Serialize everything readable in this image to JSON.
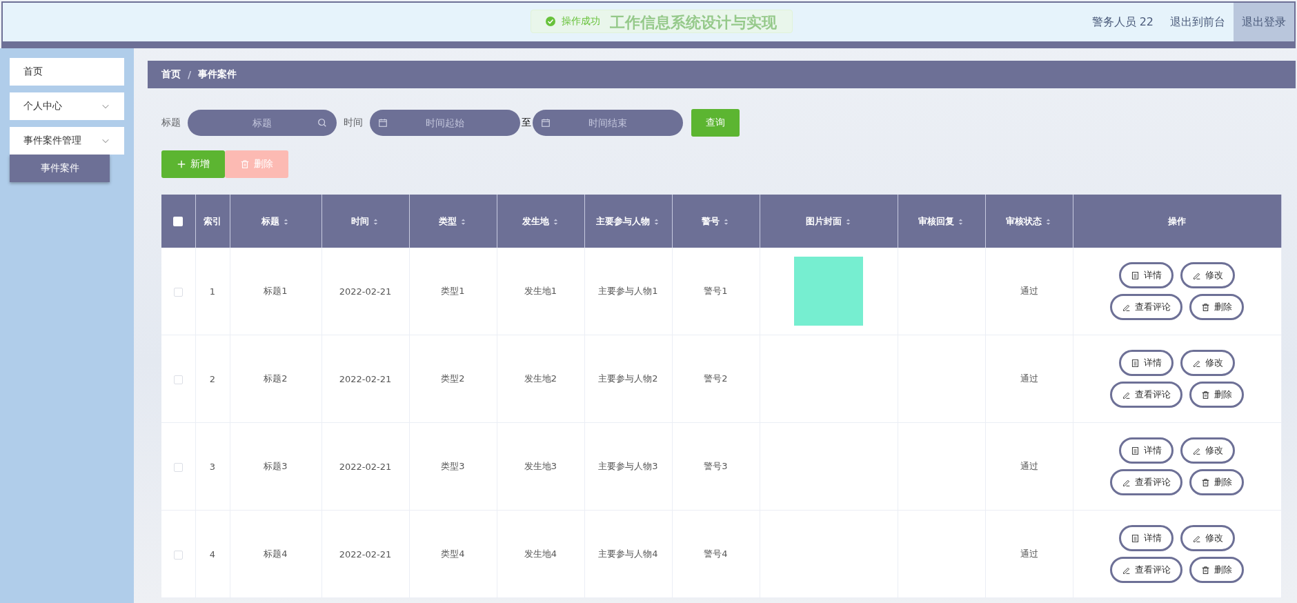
{
  "header": {
    "title": "工作信息系统设计与实现",
    "toast": "操作成功",
    "user": "警务人员 22",
    "links": [
      {
        "label": "退出到前台",
        "selected": false
      },
      {
        "label": "退出登录",
        "selected": true
      }
    ]
  },
  "sidebar": {
    "items": [
      {
        "label": "首页",
        "expandable": false
      },
      {
        "label": "个人中心",
        "expandable": true
      },
      {
        "label": "事件案件管理",
        "expandable": true,
        "children": [
          {
            "label": "事件案件",
            "selected": true
          }
        ]
      }
    ]
  },
  "breadcrumb": {
    "items": [
      "首页",
      "事件案件"
    ],
    "separator": "/"
  },
  "search": {
    "title_label": "标题",
    "title_placeholder": "标题",
    "time_label": "时间",
    "start_placeholder": "时间起始",
    "separator": "至",
    "end_placeholder": "时间结束",
    "query_button": "查询"
  },
  "actions": [
    {
      "kind": "add",
      "label": "新增",
      "disabled": false
    },
    {
      "kind": "delete",
      "label": "删除",
      "disabled": true
    }
  ],
  "table": {
    "select_all": false,
    "columns": [
      {
        "label": "索引",
        "sortable": false
      },
      {
        "label": "标题",
        "sortable": true
      },
      {
        "label": "时间",
        "sortable": true
      },
      {
        "label": "类型",
        "sortable": true
      },
      {
        "label": "发生地",
        "sortable": true
      },
      {
        "label": "主要参与人物",
        "sortable": true
      },
      {
        "label": "警号",
        "sortable": true
      },
      {
        "label": "图片封面",
        "sortable": true
      },
      {
        "label": "审核回复",
        "sortable": true
      },
      {
        "label": "审核状态",
        "sortable": true
      },
      {
        "label": "操作",
        "sortable": false
      }
    ],
    "rows": [
      {
        "checked": false,
        "index": "1",
        "title": "标题1",
        "time": "2022-02-21",
        "type": "类型1",
        "place": "发生地1",
        "persons": "主要参与人物1",
        "badge": "警号1",
        "has_image": true,
        "status": "通过",
        "buttons": [
          {
            "kind": "detail",
            "label": "详情"
          },
          {
            "kind": "edit",
            "label": "修改"
          },
          {
            "kind": "comments",
            "label": "查看评论"
          },
          {
            "kind": "delete",
            "label": "删除"
          }
        ]
      },
      {
        "checked": false,
        "index": "2",
        "title": "标题2",
        "time": "2022-02-21",
        "type": "类型2",
        "place": "发生地2",
        "persons": "主要参与人物2",
        "badge": "警号2",
        "has_image": false,
        "status": "通过",
        "buttons": [
          {
            "kind": "detail",
            "label": "详情"
          },
          {
            "kind": "edit",
            "label": "修改"
          },
          {
            "kind": "comments",
            "label": "查看评论"
          },
          {
            "kind": "delete",
            "label": "删除"
          }
        ]
      },
      {
        "checked": false,
        "index": "3",
        "title": "标题3",
        "time": "2022-02-21",
        "type": "类型3",
        "place": "发生地3",
        "persons": "主要参与人物3",
        "badge": "警号3",
        "has_image": false,
        "status": "通过",
        "buttons": [
          {
            "kind": "detail",
            "label": "详情"
          },
          {
            "kind": "edit",
            "label": "修改"
          },
          {
            "kind": "comments",
            "label": "查看评论"
          },
          {
            "kind": "delete",
            "label": "删除"
          }
        ]
      },
      {
        "checked": false,
        "index": "4",
        "title": "标题4",
        "time": "2022-02-21",
        "type": "类型4",
        "place": "发生地4",
        "persons": "主要参与人物4",
        "badge": "警号4",
        "has_image": false,
        "status": "通过",
        "buttons": [
          {
            "kind": "detail",
            "label": "详情"
          },
          {
            "kind": "edit",
            "label": "修改"
          },
          {
            "kind": "comments",
            "label": "查看评论"
          },
          {
            "kind": "delete",
            "label": "删除"
          }
        ]
      }
    ]
  }
}
